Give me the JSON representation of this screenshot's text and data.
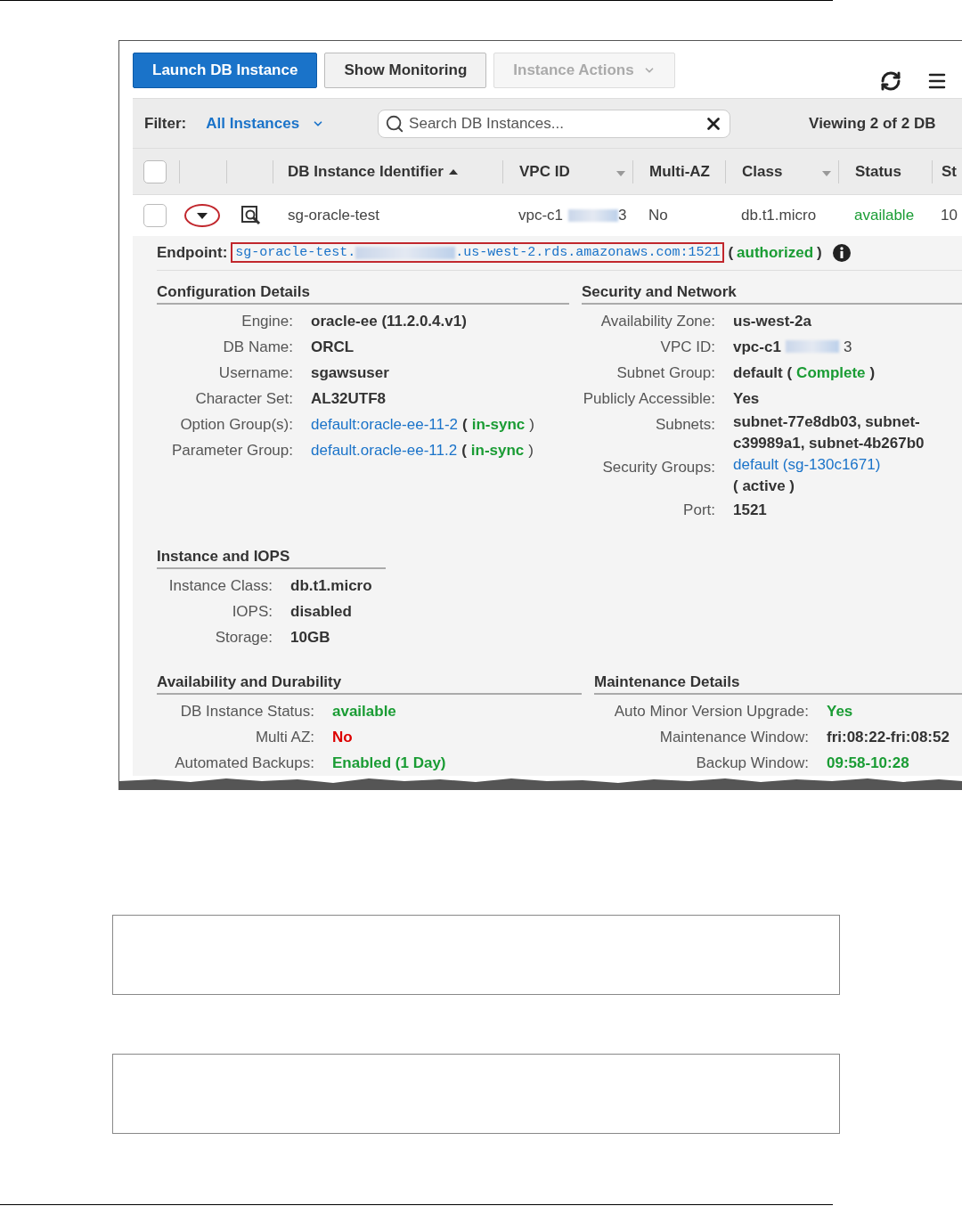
{
  "toolbar": {
    "buttons": [
      {
        "label": "Launch DB Instance",
        "kind": "primary",
        "disabled": false
      },
      {
        "label": "Show Monitoring",
        "kind": "default",
        "disabled": false
      },
      {
        "label": "Instance Actions",
        "kind": "dropdown",
        "disabled": true
      }
    ]
  },
  "filter": {
    "label": "Filter:",
    "value": "All Instances"
  },
  "search": {
    "placeholder": "Search DB Instances..."
  },
  "viewing": "Viewing 2 of 2 DB",
  "table": {
    "select_all": {
      "checked": false
    },
    "columns": [
      {
        "label": "DB Instance Identifier",
        "kind": "sorted"
      },
      {
        "label": "VPC ID",
        "kind": "menu"
      },
      {
        "label": "Multi-AZ",
        "kind": "plain"
      },
      {
        "label": "Class",
        "kind": "menu"
      },
      {
        "label": "Status",
        "kind": "plain"
      },
      {
        "label": "St",
        "kind": "plain"
      }
    ],
    "rows": [
      {
        "checked": false,
        "expanded": true,
        "cells": [
          [
            {
              "kind": "normal",
              "text": "sg-oracle-test"
            }
          ],
          [
            {
              "kind": "normal",
              "text": "vpc-c1"
            },
            {
              "kind": "redacted"
            },
            {
              "kind": "normal",
              "text": "3"
            }
          ],
          [
            {
              "kind": "normal",
              "text": "No"
            }
          ],
          [
            {
              "kind": "normal",
              "text": "db.t1.micro"
            }
          ],
          [
            {
              "kind": "okplain",
              "text": "available"
            }
          ],
          [
            {
              "kind": "normal",
              "text": "10"
            }
          ]
        ]
      }
    ]
  },
  "endpoint": {
    "label": "Endpoint:",
    "value": [
      {
        "kind": "normal",
        "text": "sg-oracle-test."
      },
      {
        "kind": "redacted"
      },
      {
        "kind": "normal",
        "text": ".us-west-2.rds.amazonaws.com:1521"
      }
    ],
    "status": [
      {
        "kind": "strong",
        "text": "("
      },
      {
        "kind": "ok",
        "text": "authorized"
      },
      {
        "kind": "strong",
        "text": ")"
      }
    ]
  },
  "rows": [
    {
      "left": {
        "title": "Configuration Details",
        "fields": [
          {
            "label": "Engine:",
            "lines": [
              [
                {
                  "kind": "strong",
                  "text": "oracle-ee (11.2.0.4.v1)"
                }
              ]
            ]
          },
          {
            "label": "DB Name:",
            "lines": [
              [
                {
                  "kind": "strong",
                  "text": "ORCL"
                }
              ]
            ]
          },
          {
            "label": "Username:",
            "lines": [
              [
                {
                  "kind": "strong",
                  "text": "sgawsuser"
                }
              ]
            ]
          },
          {
            "label": "Character Set:",
            "lines": [
              [
                {
                  "kind": "strong",
                  "text": "AL32UTF8"
                }
              ]
            ]
          },
          {
            "label": "Option Group(s):",
            "lines": [
              [
                {
                  "kind": "link",
                  "text": "default:oracle-ee-11-2"
                },
                {
                  "kind": "strong",
                  "text": "("
                },
                {
                  "kind": "ok",
                  "text": "in-sync"
                },
                {
                  "kind": "normal",
                  "text": ")"
                }
              ]
            ]
          },
          {
            "label": "Parameter Group:",
            "lines": [
              [
                {
                  "kind": "link",
                  "text": "default.oracle-ee-11.2"
                },
                {
                  "kind": "strong",
                  "text": "("
                },
                {
                  "kind": "ok",
                  "text": "in-sync"
                },
                {
                  "kind": "normal",
                  "text": ")"
                }
              ]
            ]
          }
        ]
      },
      "right": {
        "title": "Security and Network",
        "fields": [
          {
            "label": "Availability Zone:",
            "lines": [
              [
                {
                  "kind": "strong",
                  "text": "us-west-2a"
                }
              ]
            ]
          },
          {
            "label": "VPC ID:",
            "lines": [
              [
                {
                  "kind": "strong",
                  "text": "vpc-c1"
                },
                {
                  "kind": "redacted"
                },
                {
                  "kind": "normal",
                  "text": "3"
                }
              ]
            ]
          },
          {
            "label": "Subnet Group:",
            "lines": [
              [
                {
                  "kind": "strong",
                  "text": "default ("
                },
                {
                  "kind": "ok",
                  "text": "Complete"
                },
                {
                  "kind": "strong",
                  "text": ")"
                }
              ]
            ]
          },
          {
            "label": "Publicly Accessible:",
            "lines": [
              [
                {
                  "kind": "strong",
                  "text": "Yes"
                }
              ]
            ]
          },
          {
            "label": "Subnets:",
            "lines": [
              [
                {
                  "kind": "strong",
                  "text": "subnet-77e8db03, subnet-"
                }
              ],
              [
                {
                  "kind": "strong",
                  "text": "c39989a1, subnet-4b267b0"
                }
              ]
            ]
          },
          {
            "label": "Security Groups:",
            "lines": [
              [
                {
                  "kind": "link",
                  "text": "default (sg-130c1671)"
                }
              ],
              [
                {
                  "kind": "strong",
                  "text": "( active )"
                }
              ]
            ]
          },
          {
            "label": "Port:",
            "lines": [
              [
                {
                  "kind": "strong",
                  "text": "1521"
                }
              ]
            ]
          }
        ]
      }
    },
    {
      "left": {
        "title": "Instance and IOPS",
        "fields": [
          {
            "label": "Instance Class:",
            "lines": [
              [
                {
                  "kind": "strong",
                  "text": "db.t1.micro"
                }
              ]
            ]
          },
          {
            "label": "IOPS:",
            "lines": [
              [
                {
                  "kind": "strong",
                  "text": "disabled"
                }
              ]
            ]
          },
          {
            "label": "Storage:",
            "lines": [
              [
                {
                  "kind": "strong",
                  "text": "10GB"
                }
              ]
            ]
          }
        ]
      }
    },
    {
      "left": {
        "title": "Availability and Durability",
        "fields": [
          {
            "label": "DB Instance Status:",
            "lines": [
              [
                {
                  "kind": "ok",
                  "text": "available"
                }
              ]
            ]
          },
          {
            "label": "Multi AZ:",
            "lines": [
              [
                {
                  "kind": "bad",
                  "text": "No"
                }
              ]
            ]
          },
          {
            "label": "Automated Backups:",
            "lines": [
              [
                {
                  "kind": "ok",
                  "text": "Enabled (1 Day)"
                }
              ]
            ]
          }
        ]
      },
      "right": {
        "title": "Maintenance Details",
        "fields": [
          {
            "label": "Auto Minor Version Upgrade:",
            "lines": [
              [
                {
                  "kind": "ok",
                  "text": "Yes"
                }
              ]
            ]
          },
          {
            "label": "Maintenance Window:",
            "lines": [
              [
                {
                  "kind": "strong",
                  "text": "fri:08:22-fri:08:52"
                }
              ]
            ]
          },
          {
            "label": "Backup Window:",
            "lines": [
              [
                {
                  "kind": "ok",
                  "text": "09:58-10:28"
                }
              ]
            ]
          }
        ]
      }
    }
  ],
  "note_boxes": [
    {
      "kind": "empty"
    },
    {
      "kind": "empty"
    }
  ]
}
